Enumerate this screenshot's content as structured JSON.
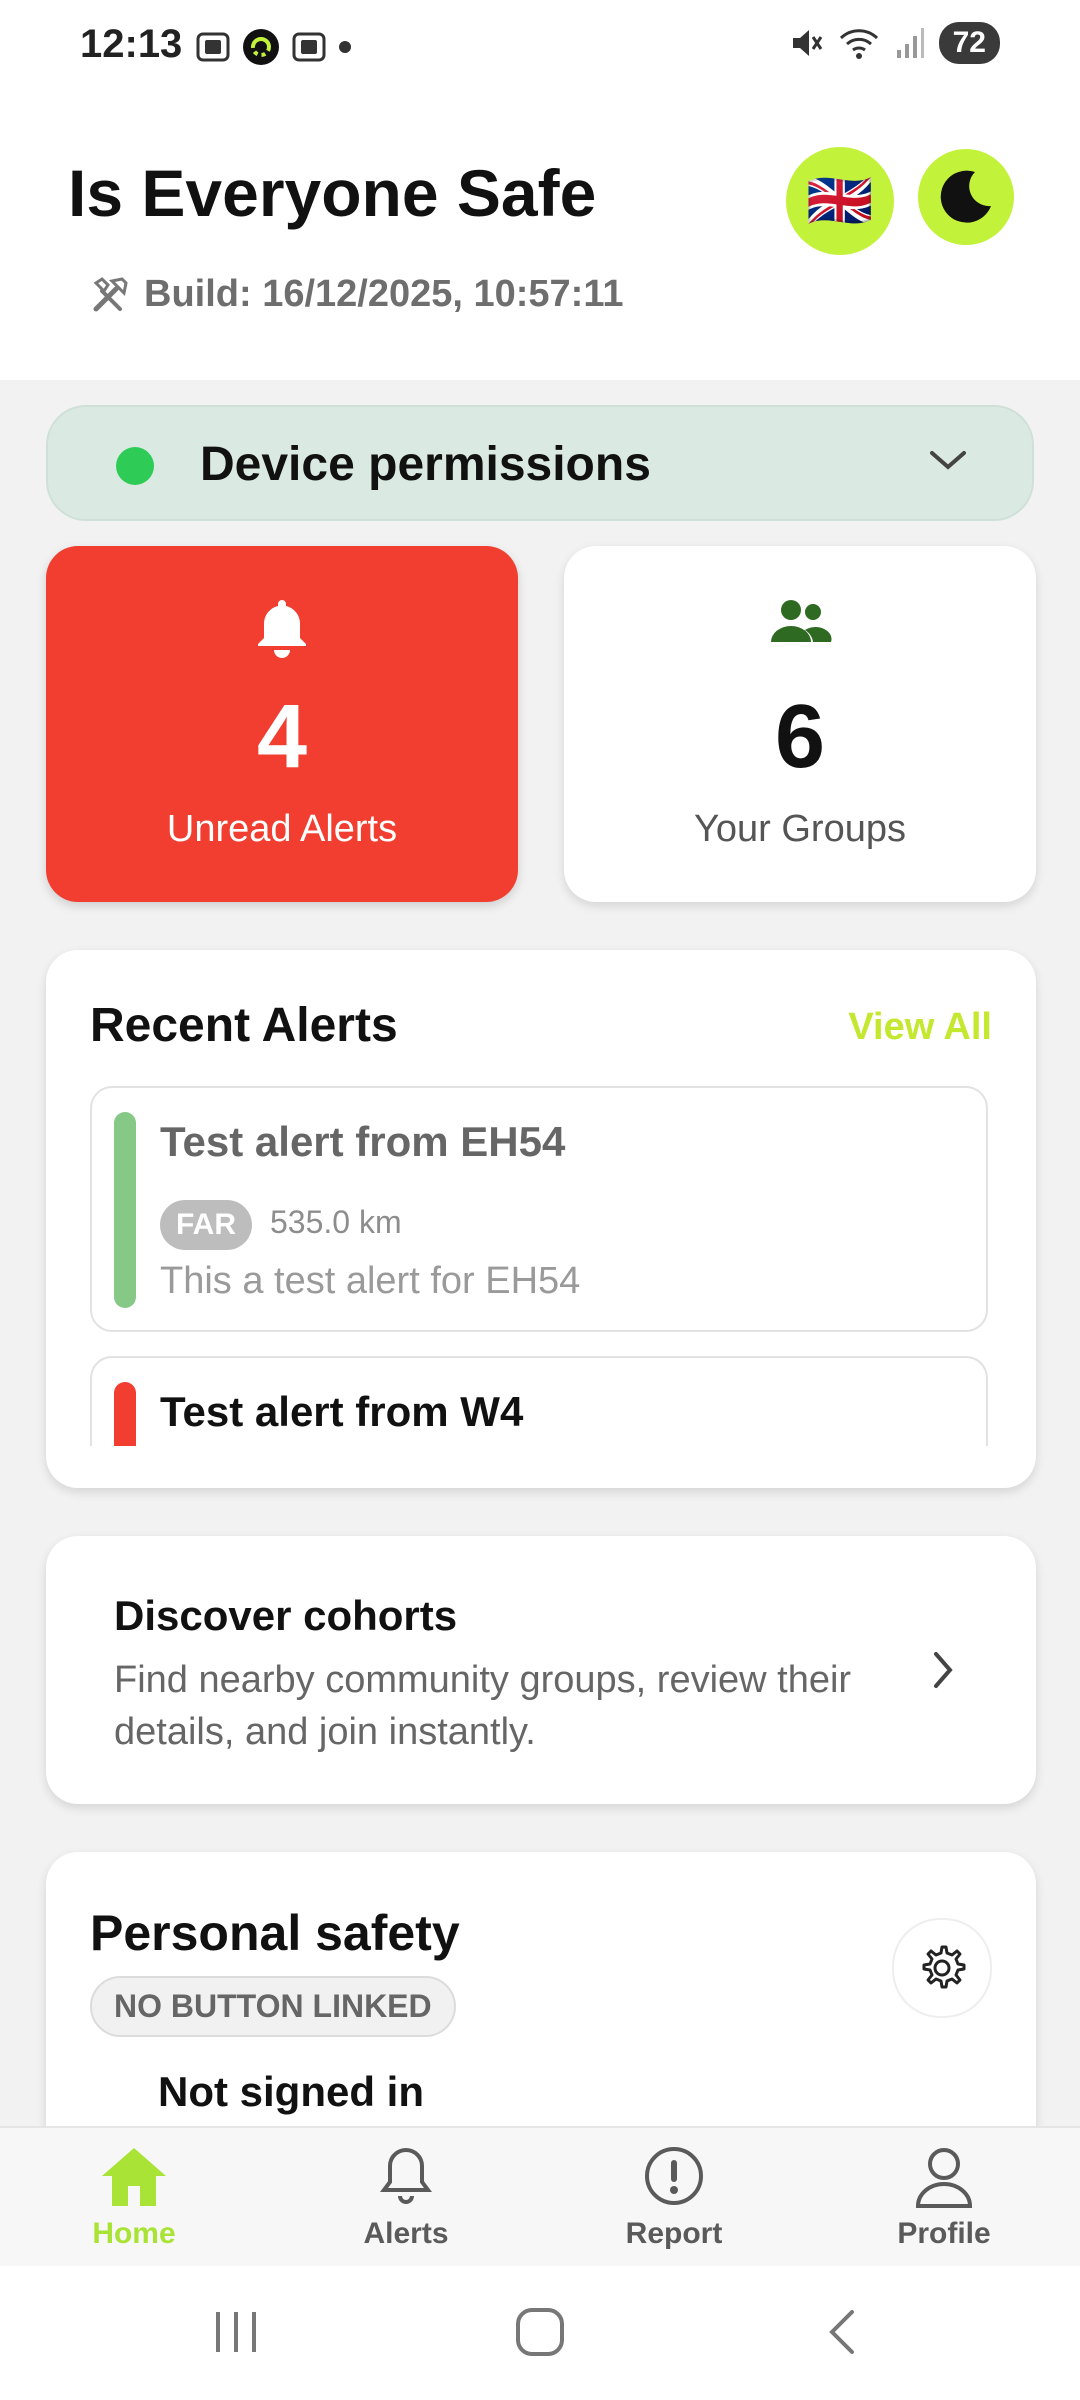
{
  "status_bar": {
    "time": "12:13",
    "battery": "72"
  },
  "header": {
    "title": "Is Everyone Safe",
    "build": "Build: 16/12/2025, 10:57:11",
    "language_flag": "🇬🇧"
  },
  "permissions": {
    "label": "Device permissions",
    "status_color": "#2ecc57"
  },
  "stats": {
    "unread_alerts": {
      "count": "4",
      "label": "Unread Alerts",
      "color": "#f13e30"
    },
    "groups": {
      "count": "6",
      "label": "Your Groups"
    }
  },
  "recent_alerts": {
    "title": "Recent Alerts",
    "view_all": "View All",
    "items": [
      {
        "title": "Test alert from EH54",
        "badge": "FAR",
        "distance": "535.0 km",
        "body": "This a test alert for EH54",
        "color": "#86c987"
      },
      {
        "title": "Test alert from W4",
        "color": "#f13e30"
      }
    ]
  },
  "discover": {
    "title": "Discover cohorts",
    "description": "Find nearby community groups, review their details, and join instantly."
  },
  "personal_safety": {
    "title": "Personal safety",
    "badge": "NO BUTTON LINKED",
    "status": "Not signed in"
  },
  "bottom_nav": {
    "items": [
      {
        "label": "Home",
        "icon": "home-icon",
        "active": true
      },
      {
        "label": "Alerts",
        "icon": "bell-icon"
      },
      {
        "label": "Report",
        "icon": "exclamation-icon"
      },
      {
        "label": "Profile",
        "icon": "person-icon"
      }
    ]
  },
  "accent_color": "#c3f23b"
}
